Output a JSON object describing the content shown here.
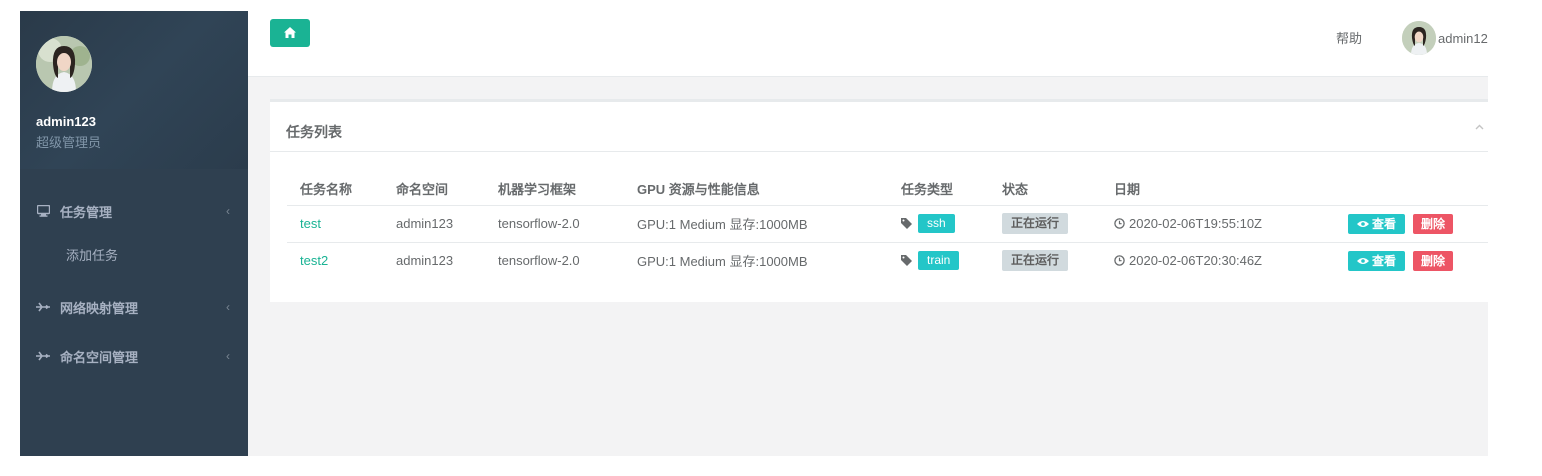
{
  "sidebar": {
    "profile": {
      "name": "admin123",
      "role": "超级管理员"
    },
    "menu": [
      {
        "label": "任务管理",
        "icon": "desktop-icon",
        "chevron": "‹"
      },
      {
        "label": "添加任务"
      },
      {
        "label": "网络映射管理",
        "icon": "plane-icon",
        "chevron": "‹"
      },
      {
        "label": "命名空间管理",
        "icon": "plane-icon",
        "chevron": "‹"
      }
    ]
  },
  "topbar": {
    "home_icon": "home-icon",
    "help": "帮助",
    "user_name": "admin12"
  },
  "panel": {
    "title": "任务列表",
    "collapse_icon": "chevron-up-icon",
    "columns": [
      "任务名称",
      "命名空间",
      "机器学习框架",
      "GPU 资源与性能信息",
      "任务类型",
      "状态",
      "日期",
      ""
    ],
    "rows": [
      {
        "name": "test",
        "namespace": "admin123",
        "framework": "tensorflow-2.0",
        "gpu": "GPU:1 Medium 显存:1000MB",
        "type": "ssh",
        "status": "正在运行",
        "date": "2020-02-06T19:55:10Z",
        "view": "查看",
        "delete": "删除"
      },
      {
        "name": "test2",
        "namespace": "admin123",
        "framework": "tensorflow-2.0",
        "gpu": "GPU:1 Medium 显存:1000MB",
        "type": "train",
        "status": "正在运行",
        "date": "2020-02-06T20:30:46Z",
        "view": "查看",
        "delete": "删除"
      }
    ]
  },
  "colors": {
    "sidebar_bg": "#2f4050",
    "primary": "#1ab394",
    "info": "#23c6c8",
    "danger": "#ed5565",
    "status_bg": "#d1dade"
  }
}
